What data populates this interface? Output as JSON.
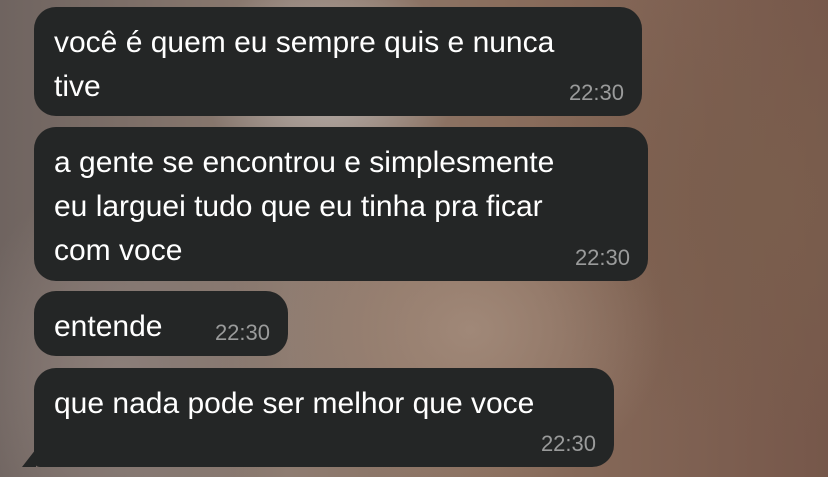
{
  "messages": [
    {
      "text": "você é quem eu sempre quis e nunca\ntive",
      "time": "22:30"
    },
    {
      "text": "a gente se encontrou e simplesmente\neu larguei tudo que eu tinha pra ficar\ncom voce",
      "time": "22:30"
    },
    {
      "text": "entende",
      "time": "22:30"
    },
    {
      "text": "que nada pode ser melhor que voce",
      "time": "22:30"
    }
  ],
  "colors": {
    "bubble_background": "#242626",
    "message_text": "#ffffff",
    "timestamp_text": "#9a9b9b"
  }
}
